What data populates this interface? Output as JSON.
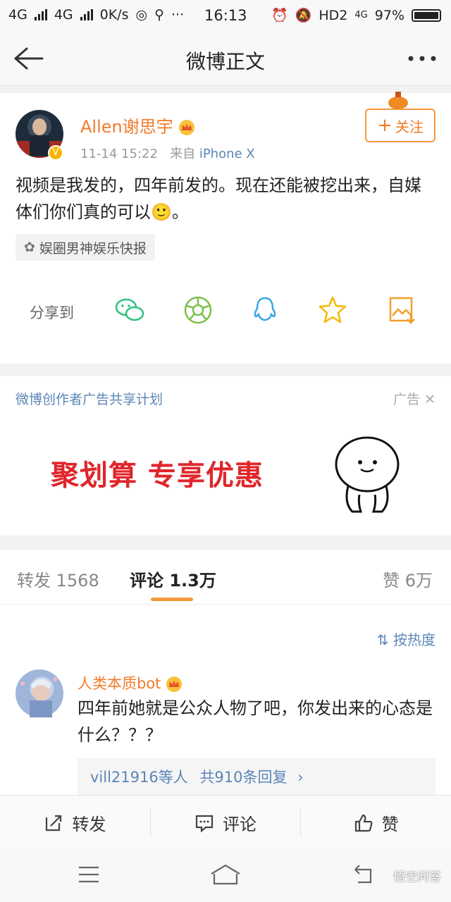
{
  "status_bar": {
    "net1": "4G",
    "net2": "4G",
    "speed": "0K/s",
    "time": "16:13",
    "hd": "HD2",
    "net3": "4G",
    "battery": "97%"
  },
  "nav": {
    "title": "微博正文"
  },
  "post": {
    "username": "Allen谢思宇",
    "time": "11-14 15:22",
    "source_prefix": "来自",
    "source": "iPhone X",
    "follow_label": "关注",
    "content": "视频是我发的，四年前发的。现在还能被挖出来，自媒体们你们真的可以🙂。",
    "tag": "娱圈男神娱乐快报",
    "share_label": "分享到"
  },
  "ad": {
    "title": "微博创作者广告共享计划",
    "label": "广告",
    "slogan": "聚划算 专享优惠"
  },
  "tabs": {
    "repost_label": "转发",
    "repost_count": "1568",
    "comment_label": "评论",
    "comment_count": "1.3万",
    "like_label": "赞",
    "like_count": "6万"
  },
  "comments": {
    "sort_label": "按热度",
    "items": [
      {
        "name": "人类本质bot",
        "text": "四年前她就是公众人物了吧，你发出来的心态是什么？？？",
        "replies_user": "vill21916等人",
        "replies_count": "共910条回复"
      }
    ]
  },
  "actions": {
    "repost": "转发",
    "comment": "评论",
    "like": "赞"
  },
  "watermark": "悟空问答",
  "colors": {
    "accent": "#f27b2a",
    "link": "#5b86b6",
    "ad_red": "#e0262b"
  }
}
